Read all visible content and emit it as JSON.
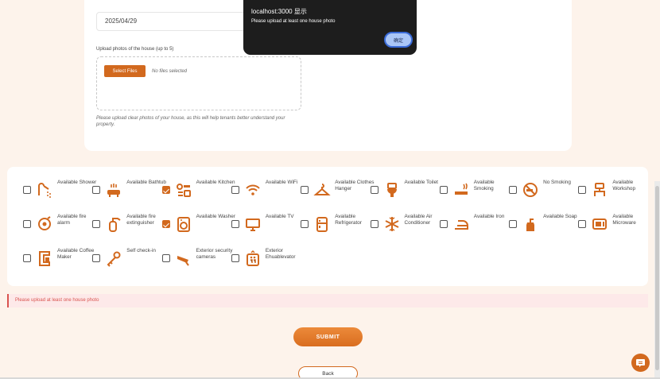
{
  "form": {
    "date_value": "2025/04/29",
    "upload_label": "Upload photos of the house (up to 5)",
    "select_files_label": "Select Files",
    "no_files_text": "No files selected",
    "upload_hint": "Please upload clear photos of your house, as this will help tenants better understand your property."
  },
  "dialog": {
    "title": "localhost:3000 显示",
    "message": "Please upload at least one house photo",
    "ok_label": "确定"
  },
  "amenities": [
    {
      "label": "Available Shower",
      "icon": "shower-icon",
      "checked": false
    },
    {
      "label": "Available Bathtub",
      "icon": "bathtub-icon",
      "checked": false
    },
    {
      "label": "Available Kitchen",
      "icon": "kitchen-icon",
      "checked": true
    },
    {
      "label": "Available WiFi",
      "icon": "wifi-icon",
      "checked": false
    },
    {
      "label": "Available Clothes Hanger",
      "icon": "hanger-icon",
      "checked": false
    },
    {
      "label": "Available Toilet",
      "icon": "toilet-icon",
      "checked": false
    },
    {
      "label": "Available Smoking",
      "icon": "smoking-icon",
      "checked": false
    },
    {
      "label": "No Smoking",
      "icon": "no-smoking-icon",
      "checked": false
    },
    {
      "label": "Available Workshop",
      "icon": "workshop-icon",
      "checked": false
    },
    {
      "label": "Available fire alarm",
      "icon": "fire-alarm-icon",
      "checked": false
    },
    {
      "label": "Available fire extinguisher",
      "icon": "fire-extinguisher-icon",
      "checked": false
    },
    {
      "label": "Available Washer",
      "icon": "washer-icon",
      "checked": true
    },
    {
      "label": "Available TV",
      "icon": "tv-icon",
      "checked": false
    },
    {
      "label": "Available Refrigerator",
      "icon": "refrigerator-icon",
      "checked": false
    },
    {
      "label": "Available Air Conditioner",
      "icon": "air-conditioner-icon",
      "checked": false
    },
    {
      "label": "Available Iron",
      "icon": "iron-icon",
      "checked": false
    },
    {
      "label": "Available Soap",
      "icon": "soap-icon",
      "checked": false
    },
    {
      "label": "Available Microware",
      "icon": "microwave-icon",
      "checked": false
    },
    {
      "label": "Available Coffee Maker",
      "icon": "coffee-maker-icon",
      "checked": false
    },
    {
      "label": "Self check-in",
      "icon": "key-icon",
      "checked": false
    },
    {
      "label": "Exterior security cameras",
      "icon": "security-camera-icon",
      "checked": false
    },
    {
      "label": "Exterior Ehuablevator",
      "icon": "elevator-icon",
      "checked": false
    }
  ],
  "error_message": "Please upload at least one house photo",
  "actions": {
    "submit_label": "SUBMIT",
    "back_label": "Back"
  },
  "colors": {
    "accent": "#d2691e",
    "error": "#d9534f"
  }
}
